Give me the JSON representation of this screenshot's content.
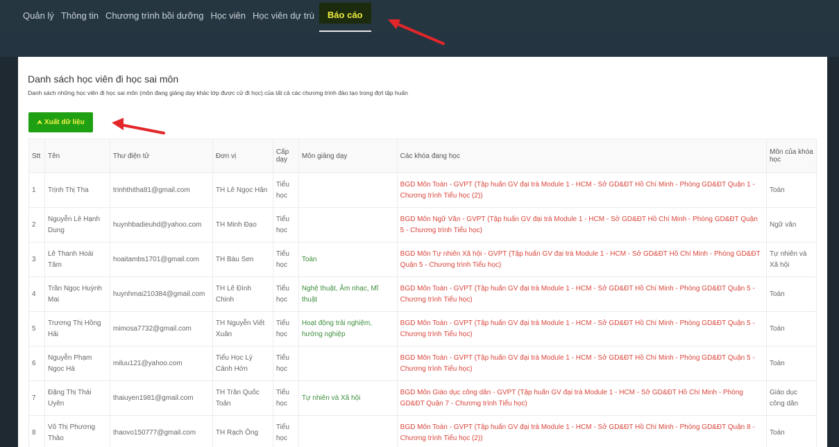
{
  "nav": {
    "items": [
      "Quản lý",
      "Thông tin",
      "Chương trình bồi dưỡng",
      "Học viên",
      "Học viên dự trù"
    ],
    "active": "Báo cáo"
  },
  "page": {
    "title": "Danh sách học viên đi học sai môn",
    "subtitle": "Danh sách những học viên đi học sai môn (môn đang giảng dạy khác lớp được cử đi học) của tất cả các chương trình đào tạo trong đợt tập huấn",
    "export_label": "Xuất dữ liệu"
  },
  "table": {
    "headers": [
      "Stt",
      "Tên",
      "Thư điện tử",
      "Đơn vị",
      "Cấp dạy",
      "Môn giảng dạy",
      "Các khóa đang học",
      "Môn của khóa học"
    ],
    "rows": [
      [
        "1",
        "Trịnh Thị Tha",
        "trinhthitha81@gmail.com",
        "TH Lê Ngọc Hân",
        "Tiểu học",
        "",
        "BGD Môn Toán - GVPT (Tập huấn GV đại trà Module 1 - HCM - Sở GD&ĐT Hồ Chí Minh - Phòng GD&ĐT Quận 1 - Chương trình Tiểu học (2))",
        "Toán"
      ],
      [
        "2",
        "Nguyễn Lê Hạnh Dung",
        "huynhbadieuhd@yahoo.com",
        "TH Minh Đạo",
        "Tiểu học",
        "",
        "BGD Môn Ngữ Văn - GVPT (Tập huấn GV đại trà Module 1 - HCM - Sở GD&ĐT Hồ Chí Minh - Phòng GD&ĐT Quận 5 - Chương trình Tiểu học)",
        "Ngữ văn"
      ],
      [
        "3",
        "Lê Thanh Hoài Tâm",
        "hoaitambs1701@gmail.com",
        "TH Bàu Sen",
        "Tiểu học",
        "Toán",
        "BGD Môn Tự nhiên Xã hội - GVPT (Tập huấn GV đại trà Module 1 - HCM - Sở GD&ĐT Hồ Chí Minh - Phòng GD&ĐT Quận 5 - Chương trình Tiểu học)",
        "Tự nhiên và Xã hội"
      ],
      [
        "4",
        "Trần Ngọc Huỳnh Mai",
        "huynhmai210384@gmail.com",
        "TH Lê Đình Chinh",
        "Tiểu học",
        "Nghệ thuật, Âm nhạc, Mĩ thuật",
        "BGD Môn Toán - GVPT (Tập huấn GV đại trà Module 1 - HCM - Sở GD&ĐT Hồ Chí Minh - Phòng GD&ĐT Quận 5 - Chương trình Tiểu học)",
        "Toán"
      ],
      [
        "5",
        "Trương Thị Hồng Hải",
        "mimosa7732@gmail.com",
        "TH Nguyễn Viết Xuân",
        "Tiểu học",
        "Hoạt động trải nghiệm, hướng nghiệp",
        "BGD Môn Toán - GVPT (Tập huấn GV đại trà Module 1 - HCM - Sở GD&ĐT Hồ Chí Minh - Phòng GD&ĐT Quận 5 - Chương trình Tiểu học)",
        "Toán"
      ],
      [
        "6",
        "Nguyễn Phạm Ngọc Hà",
        "miluu121@yahoo.com",
        "Tiểu Học Lý Cảnh Hớn",
        "Tiểu học",
        "",
        "BGD Môn Toán - GVPT (Tập huấn GV đại trà Module 1 - HCM - Sở GD&ĐT Hồ Chí Minh - Phòng GD&ĐT Quận 5 - Chương trình Tiểu học)",
        "Toán"
      ],
      [
        "7",
        "Đặng Thị Thái Uyên",
        "thaiuyen1981@gmail.com",
        "TH Trần Quốc Toản",
        "Tiểu học",
        "Tự nhiên và Xã hội",
        "BGD Môn Giáo dục công dân - GVPT (Tập huấn GV đại trà Module 1 - HCM - Sở GD&ĐT Hồ Chí Minh - Phòng GD&ĐT Quận 7 - Chương trình Tiểu học)",
        "Giáo dục công dân"
      ],
      [
        "8",
        "Võ Thị Phương Thảo",
        "thaovo150777@gmail.com",
        "TH Rạch Ông",
        "Tiểu học",
        "",
        "BGD Môn Toán - GVPT (Tập huấn GV đại trà Module 1 - HCM - Sở GD&ĐT Hồ Chí Minh - Phòng GD&ĐT Quận 8 - Chương trình Tiểu học (2))",
        "Toán"
      ]
    ]
  },
  "icons": {
    "export": "upload-icon"
  },
  "colors": {
    "accent_green": "#1ea012",
    "active_text": "#f0ee3c",
    "course_text": "#d9443a",
    "subject_text": "#3c8d3c",
    "annotation_arrow": "#e3262a"
  }
}
